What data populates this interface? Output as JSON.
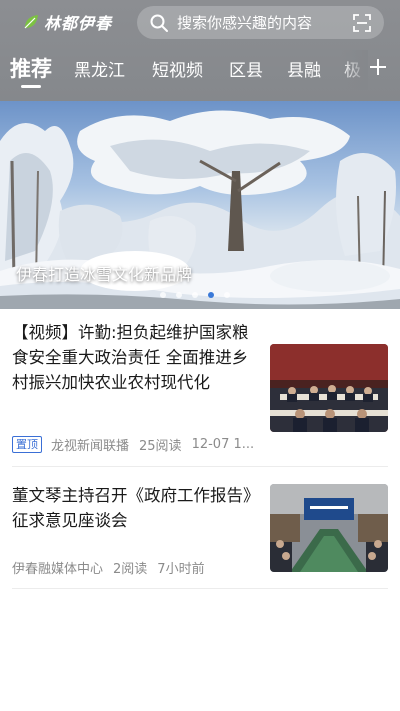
{
  "header": {
    "app_name": "林都伊春",
    "search_placeholder": "搜索你感兴趣的内容",
    "colors": {
      "header_bg": "#87898d",
      "accent": "#3a6fd6"
    }
  },
  "tabs": [
    {
      "label": "推荐",
      "active": true
    },
    {
      "label": "黑龙江"
    },
    {
      "label": "短视频"
    },
    {
      "label": "区县"
    },
    {
      "label": "县融"
    },
    {
      "label": "极"
    }
  ],
  "banner": {
    "caption": "伊春打造冰雪文化新品牌",
    "dots_count": 5,
    "active_dot": 3
  },
  "news": [
    {
      "title": "【视频】许勤:担负起维护国家粮食安全重大政治责任 全面推进乡村振兴加快农业农村现代化",
      "pinned_label": "置顶",
      "source": "龙视新闻联播",
      "reads": "25阅读",
      "time": "12-07 1..."
    },
    {
      "title": "董文琴主持召开《政府工作报告》征求意见座谈会",
      "source": "伊春融媒体中心",
      "reads": "2阅读",
      "time": "7小时前"
    }
  ]
}
